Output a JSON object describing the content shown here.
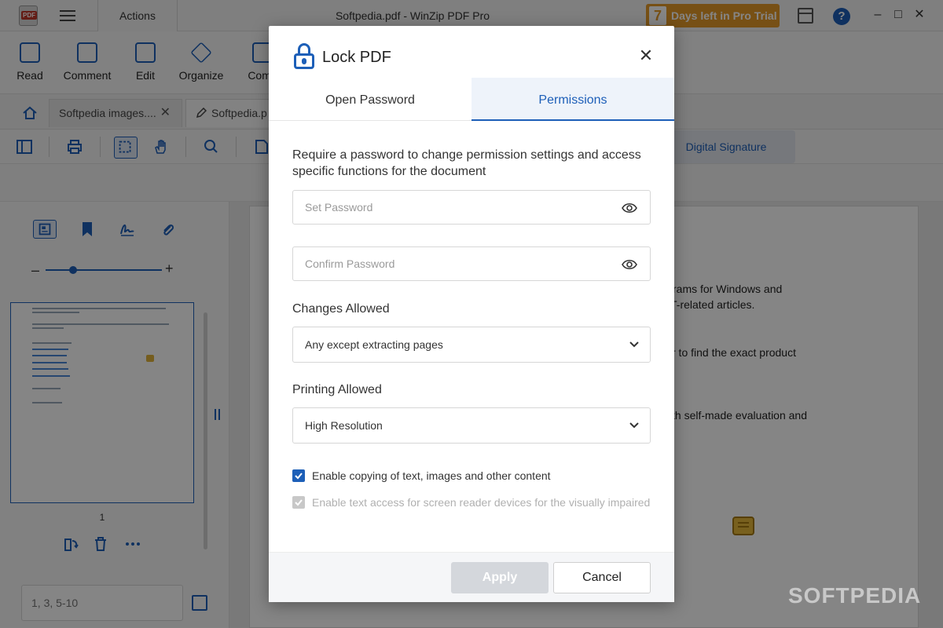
{
  "titlebar": {
    "actions_tab": "Actions",
    "window_title": "Softpedia.pdf - WinZip PDF Pro",
    "trial_days": "7",
    "trial_text": "Days left in Pro Trial",
    "app_icon_text": "PDF"
  },
  "ribbon": {
    "items": [
      {
        "label": "Read",
        "icon": "read-icon"
      },
      {
        "label": "Comment",
        "icon": "comment-icon"
      },
      {
        "label": "Edit",
        "icon": "edit-icon"
      },
      {
        "label": "Organize",
        "icon": "layers-icon"
      },
      {
        "label": "Comp",
        "icon": "compress-icon"
      }
    ]
  },
  "doctabs": {
    "tab1": "Softpedia images....",
    "tab2": "Softpedia.p"
  },
  "toolbar": {
    "digital_signature": "Digital Signature"
  },
  "leftpanel": {
    "page_number": "1",
    "page_range_placeholder": "1, 3, 5-10"
  },
  "document": {
    "lines": [
      "rams for Windows and",
      "T-related articles.",
      "r to find the exact product",
      "th self-made evaluation and"
    ]
  },
  "modal": {
    "title": "Lock PDF",
    "tabs": {
      "open_password": "Open Password",
      "permissions": "Permissions"
    },
    "description": "Require a password to change permission settings and access specific functions for the document",
    "set_password_placeholder": "Set Password",
    "confirm_password_placeholder": "Confirm Password",
    "changes_label": "Changes Allowed",
    "changes_value": "Any except extracting pages",
    "printing_label": "Printing Allowed",
    "printing_value": "High Resolution",
    "checkbox_copy": "Enable copying of text, images and other content",
    "checkbox_reader": "Enable text access for screen reader devices for the visually impaired",
    "apply": "Apply",
    "cancel": "Cancel"
  },
  "watermark": "SOFTPEDIA",
  "colors": {
    "accent": "#1d5fb8",
    "trial": "#e59a2a",
    "note": "#e7b83a"
  }
}
